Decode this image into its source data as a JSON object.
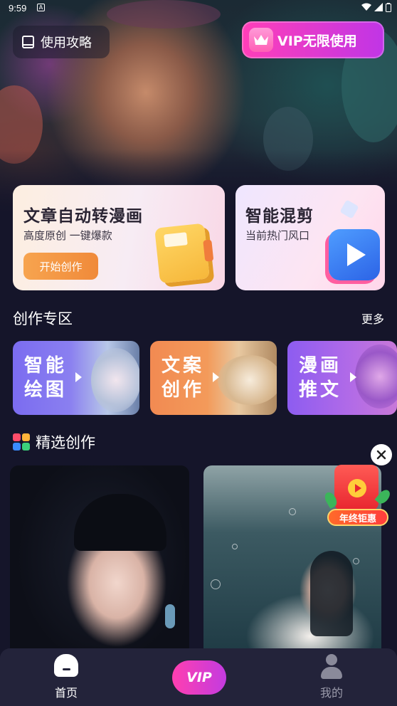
{
  "status_bar": {
    "time": "9:59",
    "notification_letter": "A"
  },
  "header": {
    "guide_label": "使用攻略",
    "vip_label": "VIP无限使用"
  },
  "features": {
    "article_card": {
      "title": "文章自动转漫画",
      "subtitle": "高度原创 一键爆款",
      "button": "开始创作"
    },
    "mix_card": {
      "title": "智能混剪",
      "subtitle": "当前热门风口"
    }
  },
  "creation_zone": {
    "title": "创作专区",
    "more": "更多",
    "tiles": [
      {
        "label": "智能绘图"
      },
      {
        "label": "文案创作"
      },
      {
        "label": "漫画推文"
      }
    ]
  },
  "featured": {
    "title": "精选创作"
  },
  "promo": {
    "label": "年终钜惠"
  },
  "bottom_nav": {
    "home": "首页",
    "vip": "VIP",
    "mine": "我的"
  },
  "colors": {
    "background": "#15152a",
    "vip_gradient_start": "#ff3fb8",
    "vip_gradient_end": "#c035e6",
    "start_button": "#f7a44f",
    "nav_background": "#23233a"
  },
  "icons": [
    "book-icon",
    "crown-icon",
    "notebook-icon",
    "play-icon",
    "chevron-right-icon",
    "grid-icon",
    "close-icon",
    "red-envelope-icon",
    "home-icon",
    "user-icon"
  ]
}
